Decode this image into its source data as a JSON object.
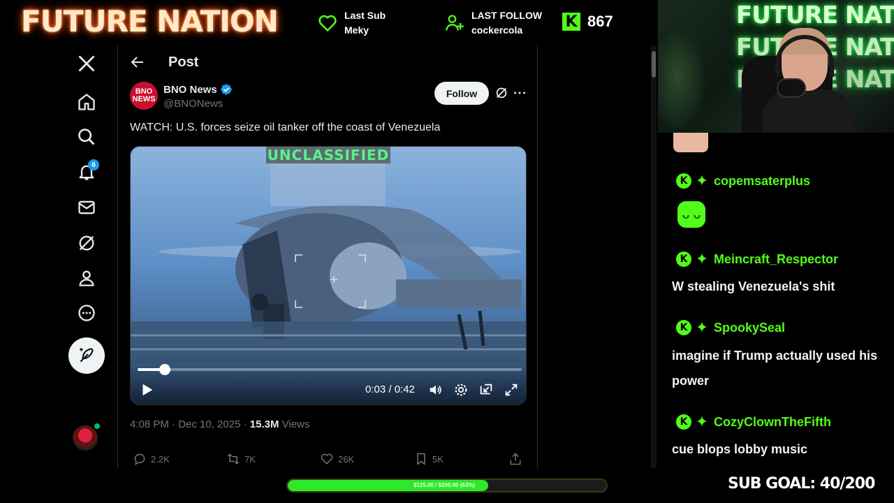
{
  "overlay": {
    "brand": "FUTURE NATION",
    "last_sub": {
      "label": "Last Sub",
      "value": "Meky"
    },
    "last_follow": {
      "label": "LAST FOLLOW",
      "value": "cockercola"
    },
    "kick_viewers": "867",
    "cam_neon": "FUTURE NATION",
    "sub_goal": "SUB GOAL: 40/200",
    "goal_bar": {
      "label": "$125.00 / $200.00 (63%)",
      "progress": 0.63
    },
    "colors": {
      "accent_green": "#53fc18",
      "brand_glow": "#ff5a1a"
    }
  },
  "twitter": {
    "nav": {
      "notifications_badge": "6",
      "icons": [
        "x-logo-icon",
        "home-icon",
        "search-icon",
        "bell-icon",
        "mail-icon",
        "grok-icon",
        "profile-icon",
        "more-icon",
        "post-icon"
      ]
    },
    "header": {
      "title": "Post"
    },
    "post": {
      "author_name": "BNO News",
      "author_handle": "@BNONews",
      "avatar_text": "BNO NEWS",
      "follow_label": "Follow",
      "text": "WATCH: U.S. forces seize oil tanker off the coast of Venezuela",
      "video": {
        "overlay_text": "UNCLASSIFIED",
        "time": "0:03 / 0:42",
        "progress": 0.07
      },
      "timestamp": "4:08 PM · Dec 10, 2025 · ",
      "views_count": "15.3M",
      "views_label": " Views",
      "stats": {
        "replies": "2.2K",
        "reposts": "7K",
        "likes": "26K",
        "bookmarks": "5K"
      }
    }
  },
  "chat": {
    "messages": [
      {
        "user": "copemsaterplus",
        "text": ""
      },
      {
        "user": "Meincraft_Respector",
        "text": "W stealing Venezuela's shit"
      },
      {
        "user": "SpookySeal",
        "text": "imagine if Trump actually used his power"
      },
      {
        "user": "CozyClownTheFifth",
        "text": "cue blops lobby music"
      }
    ]
  }
}
